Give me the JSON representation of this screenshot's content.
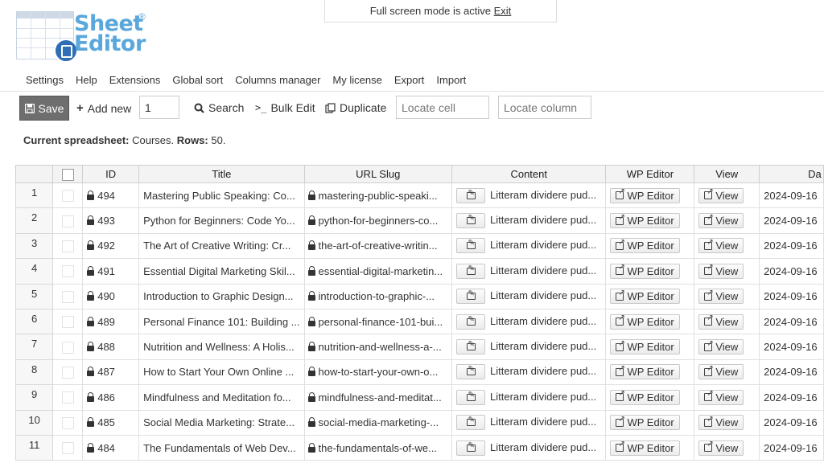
{
  "banner": {
    "text": "Full screen mode is active",
    "exit": "Exit"
  },
  "logo": {
    "line1": "Sheet",
    "line2": "Editor",
    "reg": "®"
  },
  "menu": [
    "Settings",
    "Help",
    "Extensions",
    "Global sort",
    "Columns manager",
    "My license",
    "Export",
    "Import"
  ],
  "toolbar": {
    "save": "Save",
    "add_new": "Add new",
    "add_count": "1",
    "search": "Search",
    "bulk_edit": "Bulk Edit",
    "duplicate": "Duplicate",
    "locate_cell_placeholder": "Locate cell",
    "locate_column_placeholder": "Locate column"
  },
  "sheet_info": {
    "label1": "Current spreadsheet:",
    "value1": "Courses.",
    "label2": "Rows:",
    "value2": "50."
  },
  "columns": [
    "",
    "",
    "ID",
    "Title",
    "URL Slug",
    "Content",
    "WP Editor",
    "View",
    "Da"
  ],
  "wp_editor_label": "WP Editor",
  "view_label": "View",
  "rows": [
    {
      "n": "1",
      "id": "494",
      "title": "Mastering Public Speaking: Co...",
      "slug": "mastering-public-speaki...",
      "content": "Litteram dividere pud...",
      "date": "2024-09-16"
    },
    {
      "n": "2",
      "id": "493",
      "title": "Python for Beginners: Code Yo...",
      "slug": "python-for-beginners-co...",
      "content": "Litteram dividere pud...",
      "date": "2024-09-16"
    },
    {
      "n": "3",
      "id": "492",
      "title": "The Art of Creative Writing: Cr...",
      "slug": "the-art-of-creative-writin...",
      "content": "Litteram dividere pud...",
      "date": "2024-09-16"
    },
    {
      "n": "4",
      "id": "491",
      "title": "Essential Digital Marketing Skil...",
      "slug": "essential-digital-marketin...",
      "content": "Litteram dividere pud...",
      "date": "2024-09-16"
    },
    {
      "n": "5",
      "id": "490",
      "title": "Introduction to Graphic Design...",
      "slug": "introduction-to-graphic-...",
      "content": "Litteram dividere pud...",
      "date": "2024-09-16"
    },
    {
      "n": "6",
      "id": "489",
      "title": "Personal Finance 101: Building ...",
      "slug": "personal-finance-101-bui...",
      "content": "Litteram dividere pud...",
      "date": "2024-09-16"
    },
    {
      "n": "7",
      "id": "488",
      "title": "Nutrition and Wellness: A Holis...",
      "slug": "nutrition-and-wellness-a-...",
      "content": "Litteram dividere pud...",
      "date": "2024-09-16"
    },
    {
      "n": "8",
      "id": "487",
      "title": "How to Start Your Own Online ...",
      "slug": "how-to-start-your-own-o...",
      "content": "Litteram dividere pud...",
      "date": "2024-09-16"
    },
    {
      "n": "9",
      "id": "486",
      "title": "Mindfulness and Meditation fo...",
      "slug": "mindfulness-and-meditat...",
      "content": "Litteram dividere pud...",
      "date": "2024-09-16"
    },
    {
      "n": "10",
      "id": "485",
      "title": "Social Media Marketing: Strate...",
      "slug": "social-media-marketing-...",
      "content": "Litteram dividere pud...",
      "date": "2024-09-16"
    },
    {
      "n": "11",
      "id": "484",
      "title": "The Fundamentals of Web Dev...",
      "slug": "the-fundamentals-of-we...",
      "content": "Litteram dividere pud...",
      "date": "2024-09-16"
    }
  ]
}
